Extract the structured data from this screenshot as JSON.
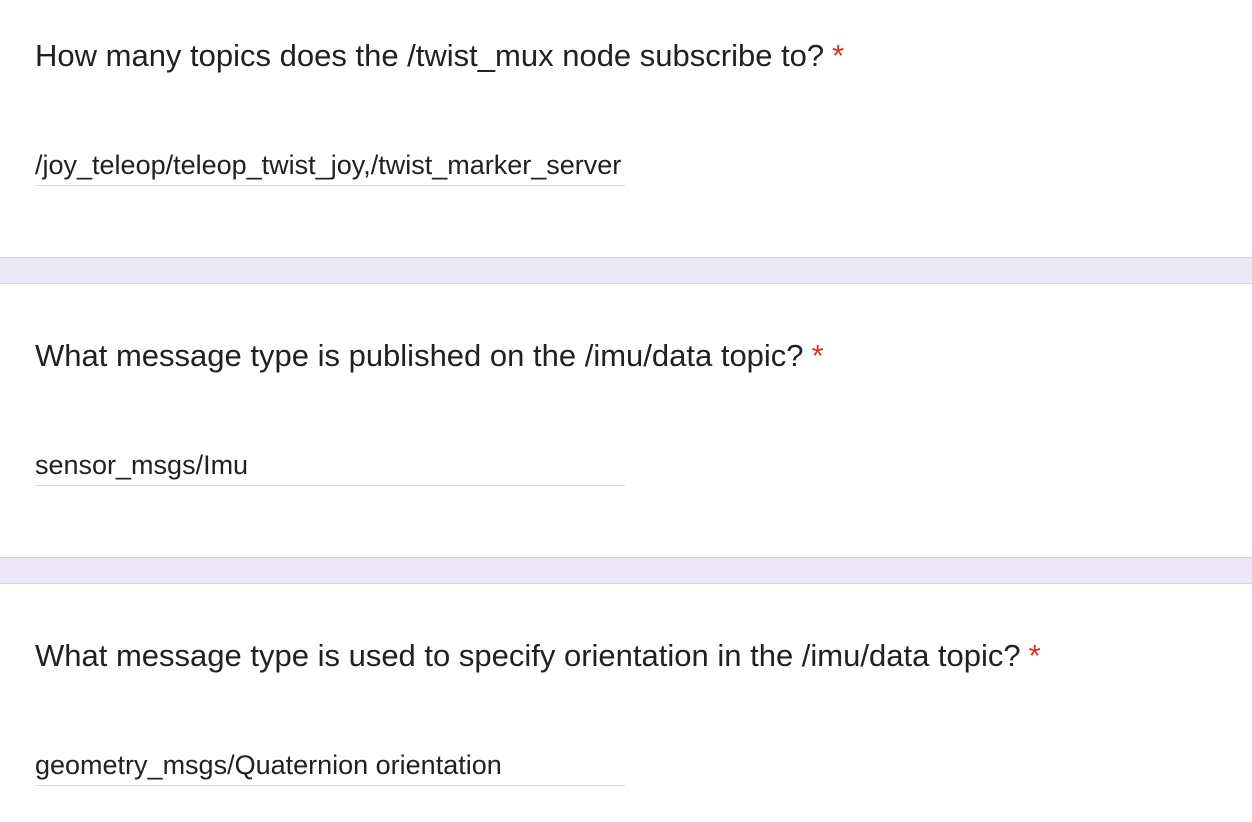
{
  "questions": [
    {
      "text": "How many topics does the /twist_mux node subscribe to?",
      "required_mark": "*",
      "answer": "/joy_teleop/teleop_twist_joy,/twist_marker_server"
    },
    {
      "text": "What message type is published on the /imu/data topic?",
      "required_mark": "*",
      "answer": "sensor_msgs/Imu"
    },
    {
      "text": "What message type is used to specify orientation in the /imu/data topic?",
      "required_mark": "*",
      "answer": "geometry_msgs/Quaternion orientation"
    }
  ],
  "colors": {
    "separator": "#ede8f7",
    "required": "#d93025",
    "text": "#202124",
    "underline": "#dadce0"
  }
}
